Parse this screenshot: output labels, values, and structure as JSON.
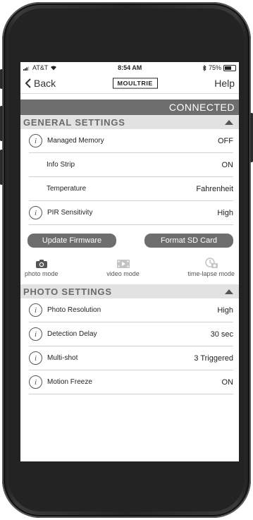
{
  "status": {
    "carrier": "AT&T",
    "time": "8:54 AM",
    "battery_pct": "75%",
    "battery_level": 0.75
  },
  "nav": {
    "back_label": "Back",
    "logo_text": "MOULTRIE",
    "help_label": "Help"
  },
  "connection_status": "CONNECTED",
  "general": {
    "title": "GENERAL SETTINGS",
    "rows": [
      {
        "label": "Managed Memory",
        "value": "OFF",
        "info": true
      },
      {
        "label": "Info Strip",
        "value": "ON",
        "info": false
      },
      {
        "label": "Temperature",
        "value": "Fahrenheit",
        "info": false
      },
      {
        "label": "PIR Sensitivity",
        "value": "High",
        "info": true
      }
    ],
    "update_firmware": "Update Firmware",
    "format_sd": "Format SD Card"
  },
  "modes": [
    {
      "label": "photo mode",
      "icon": "camera-icon",
      "active": true
    },
    {
      "label": "video mode",
      "icon": "video-icon",
      "active": false
    },
    {
      "label": "time-lapse mode",
      "icon": "time-lapse-icon",
      "active": false
    }
  ],
  "photo": {
    "title": "PHOTO SETTINGS",
    "rows": [
      {
        "label": "Photo Resolution",
        "value": "High",
        "info": true
      },
      {
        "label": "Detection Delay",
        "value": "30 sec",
        "info": true
      },
      {
        "label": "Multi-shot",
        "value": "3 Triggered",
        "info": true
      },
      {
        "label": "Motion Freeze",
        "value": "ON",
        "info": true
      }
    ]
  },
  "info_glyph": "i"
}
